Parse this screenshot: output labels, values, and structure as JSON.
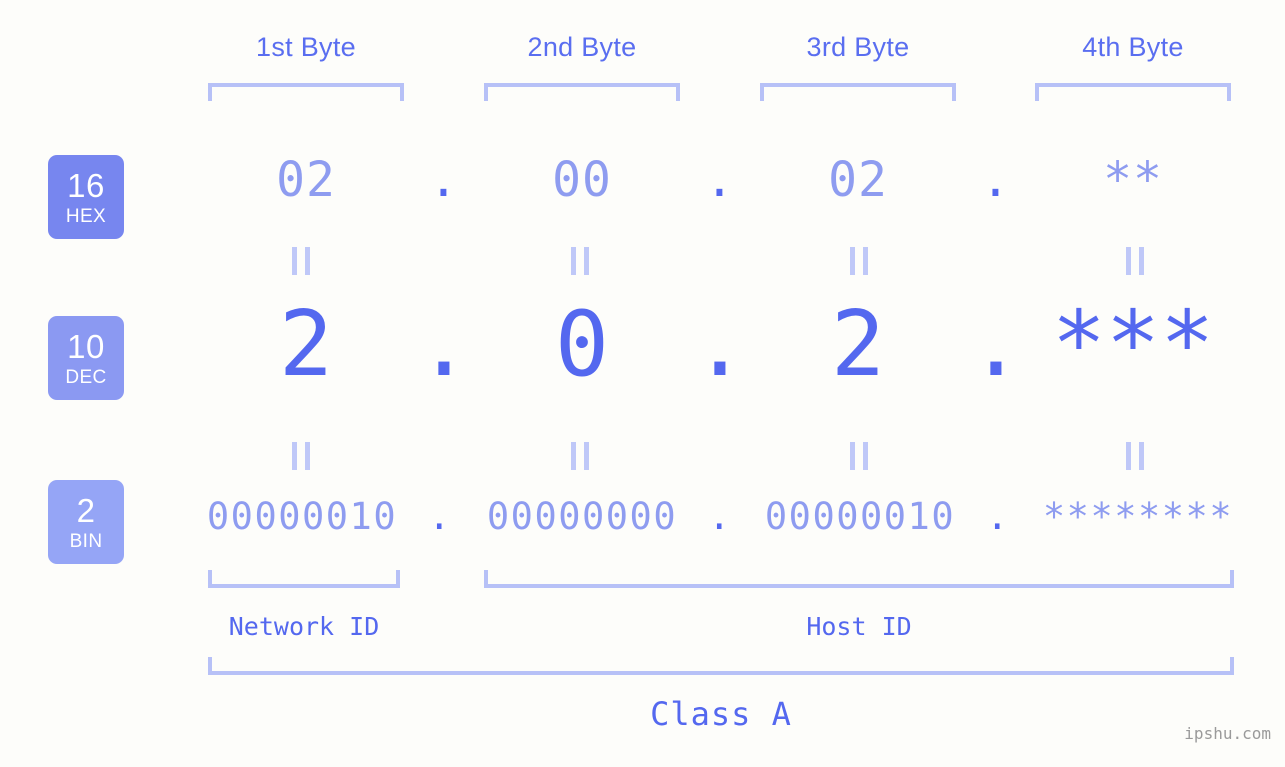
{
  "page": {
    "background_color": "#fdfdfa",
    "accent_color": "#5468ef",
    "light_accent_color": "#8e9cf0",
    "bracket_color": "#b7c1f7",
    "watermark": "ipshu.com"
  },
  "byte_headers": [
    {
      "label": "1st Byte"
    },
    {
      "label": "2nd Byte"
    },
    {
      "label": "3rd Byte"
    },
    {
      "label": "4th Byte"
    }
  ],
  "bases": [
    {
      "num": "16",
      "abbr": "HEX",
      "color": "#7786ef"
    },
    {
      "num": "10",
      "abbr": "DEC",
      "color": "#8b99f2"
    },
    {
      "num": "2",
      "abbr": "BIN",
      "color": "#95a5f6"
    }
  ],
  "rows": {
    "hex": {
      "base_num": "16",
      "base_abbr": "HEX",
      "values": [
        "02",
        "00",
        "02",
        "**"
      ],
      "separator": "."
    },
    "dec": {
      "base_num": "10",
      "base_abbr": "DEC",
      "values": [
        "2",
        "0",
        "2",
        "***"
      ],
      "separator": "."
    },
    "bin": {
      "base_num": "2",
      "base_abbr": "BIN",
      "values": [
        "00000010",
        "00000000",
        "00000010",
        "********"
      ],
      "separator": "."
    }
  },
  "equals_symbol": "=",
  "id_labels": {
    "network": "Network ID",
    "host": "Host ID"
  },
  "class_label": "Class A"
}
